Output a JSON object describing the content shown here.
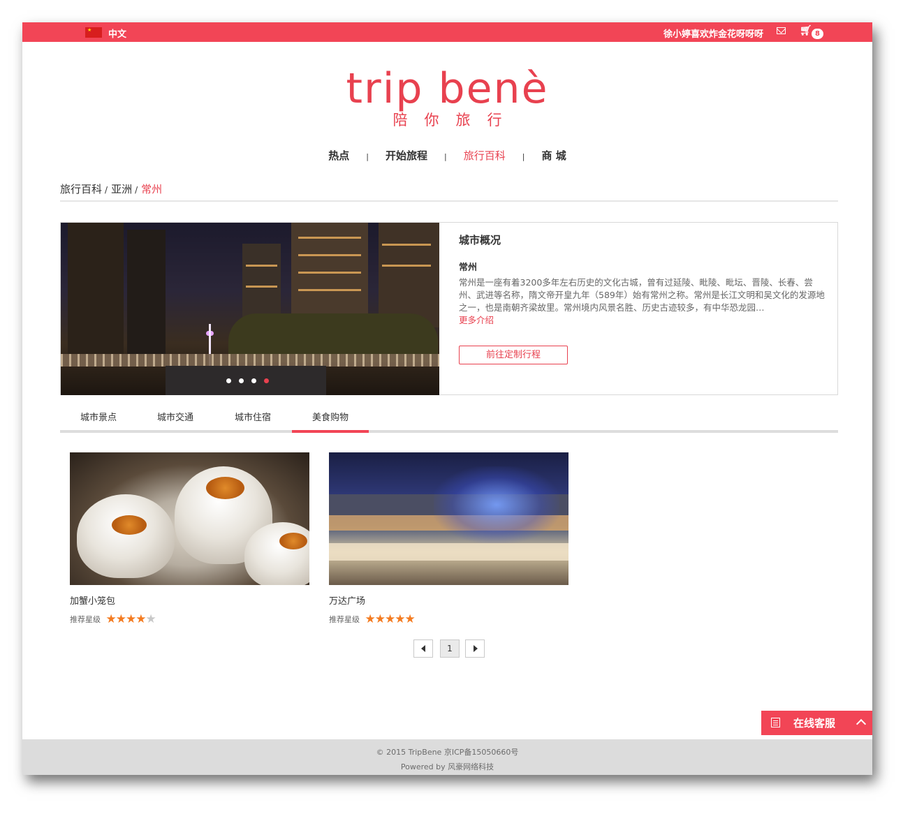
{
  "topbar": {
    "language": "中文",
    "username": "徐小婷喜欢炸金花呀呀呀",
    "cart_count": "8",
    "colors": {
      "bar": "#f24556"
    }
  },
  "logo": {
    "main": "trip benè",
    "tagline": "陪你旅行"
  },
  "nav": {
    "items": [
      {
        "label": "热点"
      },
      {
        "label": "开始旅程"
      },
      {
        "label": "旅行百科",
        "active": true
      },
      {
        "label": "商 城"
      }
    ]
  },
  "breadcrumb": {
    "items": [
      "旅行百科",
      "亚洲"
    ],
    "current": "常州"
  },
  "city": {
    "section_title": "城市概况",
    "name": "常州",
    "description": "常州是一座有着3200多年左右历史的文化古城，曾有过延陵、毗陵、毗坛、晋陵、长春、尝州、武进等名称，隋文帝开皇九年（589年）始有常州之称。常州是长江文明和吴文化的发源地之一，也是南朝齐梁故里。常州境内风景名胜、历史古迹较多，有中华恐龙园…",
    "more_label": "更多介绍",
    "plan_button": "前往定制行程",
    "slides": {
      "count": 4,
      "active_index": 3
    }
  },
  "tabs": {
    "items": [
      "城市景点",
      "城市交通",
      "城市住宿",
      "美食购物"
    ],
    "active_index": 3
  },
  "cards": [
    {
      "name": "加蟹小笼包",
      "rating_label": "推荐星级",
      "rating": 4,
      "rating_max": 5
    },
    {
      "name": "万达广场",
      "rating_label": "推荐星级",
      "rating": 5,
      "rating_max": 5
    }
  ],
  "pagination": {
    "current": "1"
  },
  "service": {
    "label": "在线客服"
  },
  "footer": {
    "line1": "© 2015 TripBene 京ICP备15050660号",
    "line2": "Powered by 风豪网络科技"
  },
  "colors": {
    "accent": "#e8414f",
    "star": "#f47b20",
    "tab_line": "#dddddd"
  }
}
